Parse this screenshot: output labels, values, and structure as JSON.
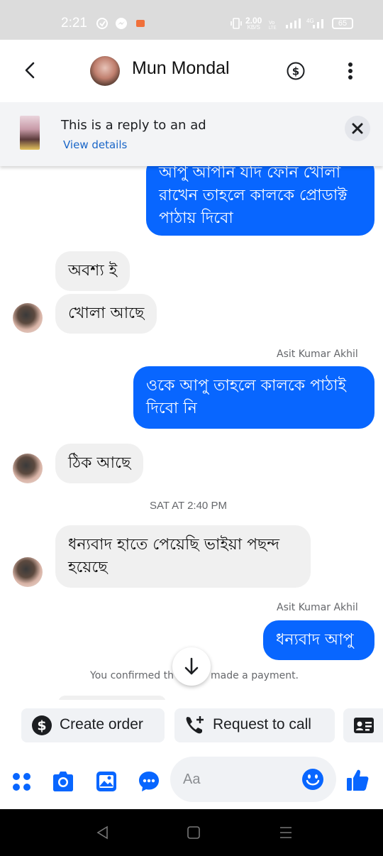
{
  "status_bar": {
    "time": "2:21",
    "speed_value": "2.00",
    "speed_unit": "KB/S",
    "battery": "65",
    "icons": [
      "sync-icon",
      "messenger-icon",
      "app-notification-icon",
      "vibrate-icon",
      "volte-icon",
      "signal-icon",
      "4g-signal-icon"
    ]
  },
  "header": {
    "contact_name": "Mun Mondal",
    "icons": [
      "back-icon",
      "dollar-icon",
      "more-icon"
    ]
  },
  "ad_banner": {
    "title": "This is a reply to an ad",
    "link": "View details"
  },
  "messages": {
    "m1": "আপু আপনি যদি ফোন খোলা রাখেন তাহলে কালকে প্রোডাক্ট পাঠায় দিবো",
    "m1_line1": "আপু আপনি যদি ফোন খোলা",
    "m1_line2": "রাখেন তাহলে কালকে প্রোডাক্ট",
    "m1_line3": "পাঠায় দিবো",
    "m2": "অবশ্য ই",
    "m3": "খোলা আছে",
    "sender1": "Asit Kumar Akhil",
    "m4_line1": "ওকে আপু তাহলে কালকে পাঠাই",
    "m4_line2": "দিবো নি",
    "m5": "ঠিক আছে",
    "timestamp": "SAT AT 2:40 PM",
    "m6_line1": "ধন্যবাদ হাতে পেয়েছি ভাইয়া পছন্দ",
    "m6_line2": "হয়েছে",
    "sender2": "Asit Kumar Akhil",
    "m7": "ধন্যবাদ আপু",
    "system_part1": "You confirmed th",
    "system_part2": "made a payment."
  },
  "quick_actions": {
    "create_order": "Create order",
    "request_call": "Request to call"
  },
  "composer": {
    "placeholder": "Aa"
  },
  "colors": {
    "accent": "#0866ff",
    "bubble_in": "#f0f0f0",
    "icon_blue": "#0866ff"
  }
}
